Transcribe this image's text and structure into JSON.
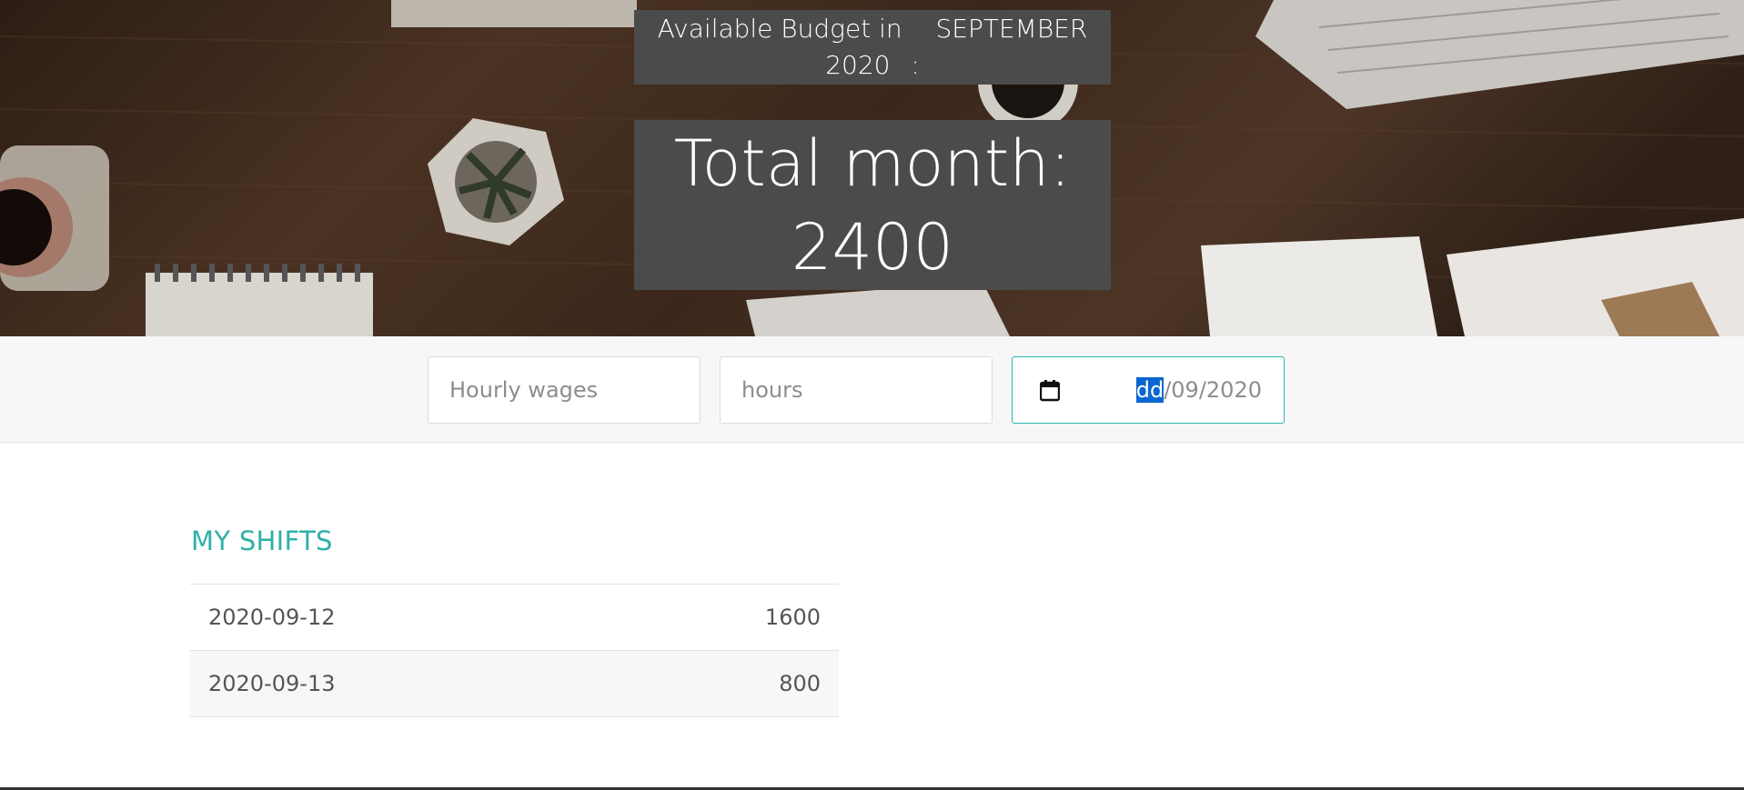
{
  "header": {
    "budget_label": "Available Budget in",
    "month": "SEPTEMBER",
    "year": "2020",
    "colon": ":",
    "total_label": "Total month:",
    "total_value": "2400"
  },
  "form": {
    "wage_placeholder": "Hourly wages",
    "hours_placeholder": "hours",
    "date_day": "dd",
    "date_rest": "/09/2020"
  },
  "shifts": {
    "title": "MY SHIFTS",
    "rows": [
      {
        "date": "2020-09-12",
        "amount": "1600"
      },
      {
        "date": "2020-09-13",
        "amount": "800"
      }
    ]
  },
  "colors": {
    "accent": "#2fb0a8",
    "selection": "#0a66d1",
    "panel": "#4b4b4b"
  }
}
